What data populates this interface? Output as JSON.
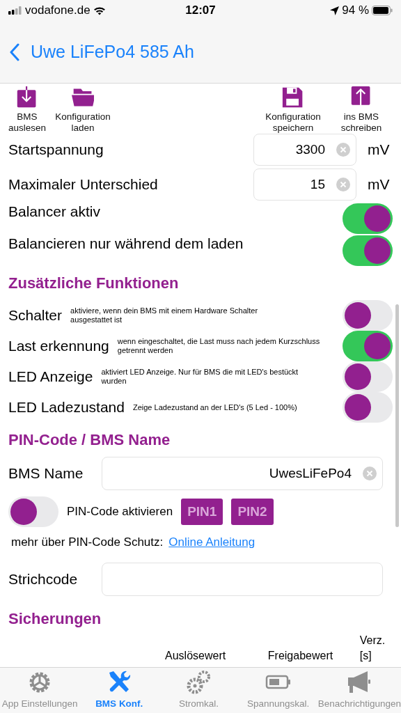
{
  "status_bar": {
    "carrier": "vodafone.de",
    "time": "12:07",
    "battery": "94 %"
  },
  "nav": {
    "back_title": "Uwe LiFePo4 585 Ah"
  },
  "toolbar": [
    {
      "label": "BMS auslesen",
      "kind": "download"
    },
    {
      "label": "Konfiguration laden",
      "kind": "folder"
    },
    {
      "label": "Konfiguration speichern",
      "kind": "save"
    },
    {
      "label": "ins BMS schreiben",
      "kind": "upload"
    }
  ],
  "settings": [
    {
      "kind": "field",
      "label": "Startspannung",
      "value": "3300",
      "unit": "mV"
    },
    {
      "kind": "field",
      "label": "Maximaler Unterschied",
      "value": "15",
      "unit": "mV"
    },
    {
      "kind": "switch",
      "label": "Balancer aktiv",
      "on": true
    },
    {
      "kind": "switch",
      "label": "Balancieren nur während dem laden",
      "on": true
    }
  ],
  "functions": {
    "title": "Zusätzliche Funktionen",
    "items": [
      {
        "label": "Schalter",
        "description": "aktiviere, wenn dein BMS mit einem Hardware Schalter ausgestattet ist",
        "on": false
      },
      {
        "label": "Last erkennung",
        "description": "wenn eingeschaltet, die Last muss nach jedem Kurzschluss getrennt werden",
        "on": true
      },
      {
        "label": "LED Anzeige",
        "description": "aktiviert LED Anzeige. Nur für BMS die mit LED's bestückt wurden",
        "on": false
      },
      {
        "label": "LED Ladezustand",
        "description": "Zeige Ladezustand an der LED's (5 Led - 100%)",
        "on": false
      }
    ]
  },
  "pin_section": {
    "title": "PIN-Code / BMS Name",
    "bms_name": {
      "label": "BMS Name",
      "value": "UwesLiFePo4"
    },
    "pin_switch": {
      "label": "PIN-Code aktivieren",
      "on": false
    },
    "pin_buttons": [
      "PIN1",
      "PIN2"
    ],
    "info": {
      "text": "mehr über PIN-Code Schutz:",
      "link": "Online Anleitung"
    },
    "barcode": {
      "label": "Strichcode"
    }
  },
  "fuses": {
    "title": "Sicherungen",
    "columns": [
      "Auslösewert",
      "Freigabewert",
      "Verz. [s]"
    ]
  },
  "tab_bar": [
    {
      "label": "App Einstellungen",
      "kind": "gear",
      "selected": false
    },
    {
      "label": "BMS Konf.",
      "kind": "tools",
      "selected": true
    },
    {
      "label": "Stromkal.",
      "kind": "gears",
      "selected": false
    },
    {
      "label": "Spannungskal.",
      "kind": "battery",
      "selected": false
    },
    {
      "label": "Benachrichtigungen",
      "kind": "megaphone",
      "selected": false
    }
  ]
}
